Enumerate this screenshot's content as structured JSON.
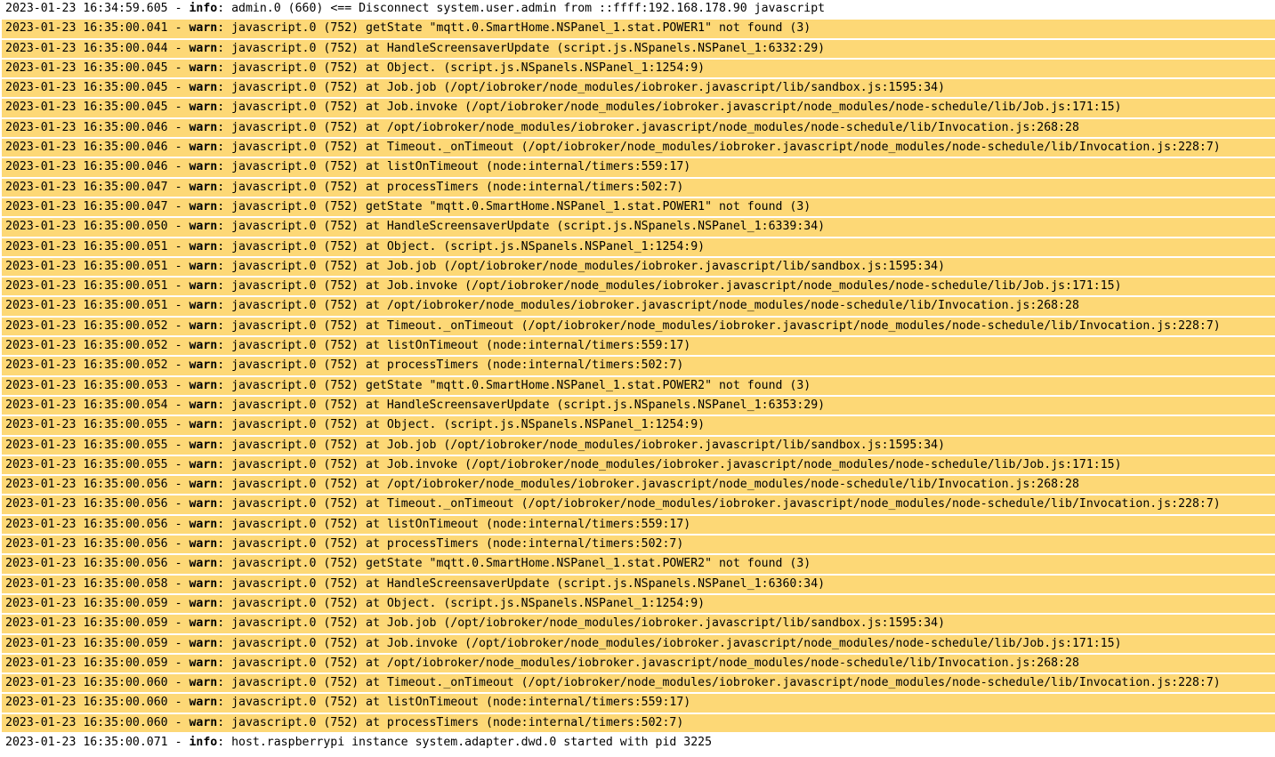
{
  "colors": {
    "warn_background": "#fdd876",
    "info_background": "#ffffff",
    "text": "#000000"
  },
  "log_entries": [
    {
      "timestamp": "2023-01-23 16:34:59.605",
      "level": "info",
      "source": "admin.0",
      "pid": "660",
      "message": "<== Disconnect system.user.admin from ::ffff:192.168.178.90 javascript"
    },
    {
      "timestamp": "2023-01-23 16:35:00.041",
      "level": "warn",
      "source": "javascript.0",
      "pid": "752",
      "message": "getState \"mqtt.0.SmartHome.NSPanel_1.stat.POWER1\" not found (3)"
    },
    {
      "timestamp": "2023-01-23 16:35:00.044",
      "level": "warn",
      "source": "javascript.0",
      "pid": "752",
      "message": "at HandleScreensaverUpdate (script.js.NSpanels.NSPanel_1:6332:29)"
    },
    {
      "timestamp": "2023-01-23 16:35:00.045",
      "level": "warn",
      "source": "javascript.0",
      "pid": "752",
      "message": "at Object. (script.js.NSpanels.NSPanel_1:1254:9)"
    },
    {
      "timestamp": "2023-01-23 16:35:00.045",
      "level": "warn",
      "source": "javascript.0",
      "pid": "752",
      "message": "at Job.job (/opt/iobroker/node_modules/iobroker.javascript/lib/sandbox.js:1595:34)"
    },
    {
      "timestamp": "2023-01-23 16:35:00.045",
      "level": "warn",
      "source": "javascript.0",
      "pid": "752",
      "message": "at Job.invoke (/opt/iobroker/node_modules/iobroker.javascript/node_modules/node-schedule/lib/Job.js:171:15)"
    },
    {
      "timestamp": "2023-01-23 16:35:00.046",
      "level": "warn",
      "source": "javascript.0",
      "pid": "752",
      "message": "at /opt/iobroker/node_modules/iobroker.javascript/node_modules/node-schedule/lib/Invocation.js:268:28"
    },
    {
      "timestamp": "2023-01-23 16:35:00.046",
      "level": "warn",
      "source": "javascript.0",
      "pid": "752",
      "message": "at Timeout._onTimeout (/opt/iobroker/node_modules/iobroker.javascript/node_modules/node-schedule/lib/Invocation.js:228:7)"
    },
    {
      "timestamp": "2023-01-23 16:35:00.046",
      "level": "warn",
      "source": "javascript.0",
      "pid": "752",
      "message": "at listOnTimeout (node:internal/timers:559:17)"
    },
    {
      "timestamp": "2023-01-23 16:35:00.047",
      "level": "warn",
      "source": "javascript.0",
      "pid": "752",
      "message": "at processTimers (node:internal/timers:502:7)"
    },
    {
      "timestamp": "2023-01-23 16:35:00.047",
      "level": "warn",
      "source": "javascript.0",
      "pid": "752",
      "message": "getState \"mqtt.0.SmartHome.NSPanel_1.stat.POWER1\" not found (3)"
    },
    {
      "timestamp": "2023-01-23 16:35:00.050",
      "level": "warn",
      "source": "javascript.0",
      "pid": "752",
      "message": "at HandleScreensaverUpdate (script.js.NSpanels.NSPanel_1:6339:34)"
    },
    {
      "timestamp": "2023-01-23 16:35:00.051",
      "level": "warn",
      "source": "javascript.0",
      "pid": "752",
      "message": "at Object. (script.js.NSpanels.NSPanel_1:1254:9)"
    },
    {
      "timestamp": "2023-01-23 16:35:00.051",
      "level": "warn",
      "source": "javascript.0",
      "pid": "752",
      "message": "at Job.job (/opt/iobroker/node_modules/iobroker.javascript/lib/sandbox.js:1595:34)"
    },
    {
      "timestamp": "2023-01-23 16:35:00.051",
      "level": "warn",
      "source": "javascript.0",
      "pid": "752",
      "message": "at Job.invoke (/opt/iobroker/node_modules/iobroker.javascript/node_modules/node-schedule/lib/Job.js:171:15)"
    },
    {
      "timestamp": "2023-01-23 16:35:00.051",
      "level": "warn",
      "source": "javascript.0",
      "pid": "752",
      "message": "at /opt/iobroker/node_modules/iobroker.javascript/node_modules/node-schedule/lib/Invocation.js:268:28"
    },
    {
      "timestamp": "2023-01-23 16:35:00.052",
      "level": "warn",
      "source": "javascript.0",
      "pid": "752",
      "message": "at Timeout._onTimeout (/opt/iobroker/node_modules/iobroker.javascript/node_modules/node-schedule/lib/Invocation.js:228:7)"
    },
    {
      "timestamp": "2023-01-23 16:35:00.052",
      "level": "warn",
      "source": "javascript.0",
      "pid": "752",
      "message": "at listOnTimeout (node:internal/timers:559:17)"
    },
    {
      "timestamp": "2023-01-23 16:35:00.052",
      "level": "warn",
      "source": "javascript.0",
      "pid": "752",
      "message": "at processTimers (node:internal/timers:502:7)"
    },
    {
      "timestamp": "2023-01-23 16:35:00.053",
      "level": "warn",
      "source": "javascript.0",
      "pid": "752",
      "message": "getState \"mqtt.0.SmartHome.NSPanel_1.stat.POWER2\" not found (3)"
    },
    {
      "timestamp": "2023-01-23 16:35:00.054",
      "level": "warn",
      "source": "javascript.0",
      "pid": "752",
      "message": "at HandleScreensaverUpdate (script.js.NSpanels.NSPanel_1:6353:29)"
    },
    {
      "timestamp": "2023-01-23 16:35:00.055",
      "level": "warn",
      "source": "javascript.0",
      "pid": "752",
      "message": "at Object. (script.js.NSpanels.NSPanel_1:1254:9)"
    },
    {
      "timestamp": "2023-01-23 16:35:00.055",
      "level": "warn",
      "source": "javascript.0",
      "pid": "752",
      "message": "at Job.job (/opt/iobroker/node_modules/iobroker.javascript/lib/sandbox.js:1595:34)"
    },
    {
      "timestamp": "2023-01-23 16:35:00.055",
      "level": "warn",
      "source": "javascript.0",
      "pid": "752",
      "message": "at Job.invoke (/opt/iobroker/node_modules/iobroker.javascript/node_modules/node-schedule/lib/Job.js:171:15)"
    },
    {
      "timestamp": "2023-01-23 16:35:00.056",
      "level": "warn",
      "source": "javascript.0",
      "pid": "752",
      "message": "at /opt/iobroker/node_modules/iobroker.javascript/node_modules/node-schedule/lib/Invocation.js:268:28"
    },
    {
      "timestamp": "2023-01-23 16:35:00.056",
      "level": "warn",
      "source": "javascript.0",
      "pid": "752",
      "message": "at Timeout._onTimeout (/opt/iobroker/node_modules/iobroker.javascript/node_modules/node-schedule/lib/Invocation.js:228:7)"
    },
    {
      "timestamp": "2023-01-23 16:35:00.056",
      "level": "warn",
      "source": "javascript.0",
      "pid": "752",
      "message": "at listOnTimeout (node:internal/timers:559:17)"
    },
    {
      "timestamp": "2023-01-23 16:35:00.056",
      "level": "warn",
      "source": "javascript.0",
      "pid": "752",
      "message": "at processTimers (node:internal/timers:502:7)"
    },
    {
      "timestamp": "2023-01-23 16:35:00.056",
      "level": "warn",
      "source": "javascript.0",
      "pid": "752",
      "message": "getState \"mqtt.0.SmartHome.NSPanel_1.stat.POWER2\" not found (3)"
    },
    {
      "timestamp": "2023-01-23 16:35:00.058",
      "level": "warn",
      "source": "javascript.0",
      "pid": "752",
      "message": "at HandleScreensaverUpdate (script.js.NSpanels.NSPanel_1:6360:34)"
    },
    {
      "timestamp": "2023-01-23 16:35:00.059",
      "level": "warn",
      "source": "javascript.0",
      "pid": "752",
      "message": "at Object. (script.js.NSpanels.NSPanel_1:1254:9)"
    },
    {
      "timestamp": "2023-01-23 16:35:00.059",
      "level": "warn",
      "source": "javascript.0",
      "pid": "752",
      "message": "at Job.job (/opt/iobroker/node_modules/iobroker.javascript/lib/sandbox.js:1595:34)"
    },
    {
      "timestamp": "2023-01-23 16:35:00.059",
      "level": "warn",
      "source": "javascript.0",
      "pid": "752",
      "message": "at Job.invoke (/opt/iobroker/node_modules/iobroker.javascript/node_modules/node-schedule/lib/Job.js:171:15)"
    },
    {
      "timestamp": "2023-01-23 16:35:00.059",
      "level": "warn",
      "source": "javascript.0",
      "pid": "752",
      "message": "at /opt/iobroker/node_modules/iobroker.javascript/node_modules/node-schedule/lib/Invocation.js:268:28"
    },
    {
      "timestamp": "2023-01-23 16:35:00.060",
      "level": "warn",
      "source": "javascript.0",
      "pid": "752",
      "message": "at Timeout._onTimeout (/opt/iobroker/node_modules/iobroker.javascript/node_modules/node-schedule/lib/Invocation.js:228:7)"
    },
    {
      "timestamp": "2023-01-23 16:35:00.060",
      "level": "warn",
      "source": "javascript.0",
      "pid": "752",
      "message": "at listOnTimeout (node:internal/timers:559:17)"
    },
    {
      "timestamp": "2023-01-23 16:35:00.060",
      "level": "warn",
      "source": "javascript.0",
      "pid": "752",
      "message": "at processTimers (node:internal/timers:502:7)"
    },
    {
      "timestamp": "2023-01-23 16:35:00.071",
      "level": "info",
      "source": "host.raspberrypi",
      "pid": "",
      "message": "instance system.adapter.dwd.0 started with pid 3225"
    }
  ]
}
